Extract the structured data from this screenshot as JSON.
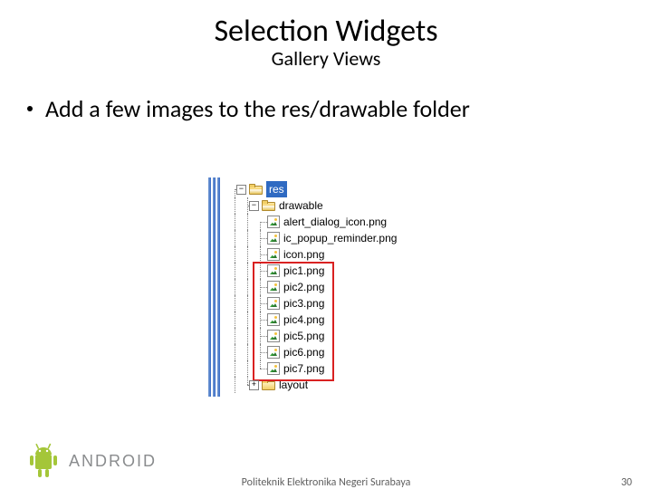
{
  "title": "Selection Widgets",
  "subtitle": "Gallery Views",
  "bullet": "Add a few images to the res/drawable folder",
  "tree": {
    "root": {
      "label": "res",
      "selected": true
    },
    "folders": [
      {
        "label": "drawable",
        "expanded": true
      },
      {
        "label": "layout",
        "expanded": false
      }
    ],
    "files": [
      "alert_dialog_icon.png",
      "ic_popup_reminder.png",
      "icon.png",
      "pic1.png",
      "pic2.png",
      "pic3.png",
      "pic4.png",
      "pic5.png",
      "pic6.png",
      "pic7.png"
    ],
    "highlight_start": 3,
    "highlight_end": 9
  },
  "footer": "Politeknik Elektronika Negeri Surabaya",
  "page_number": "30",
  "logo_text": "ANDROID"
}
